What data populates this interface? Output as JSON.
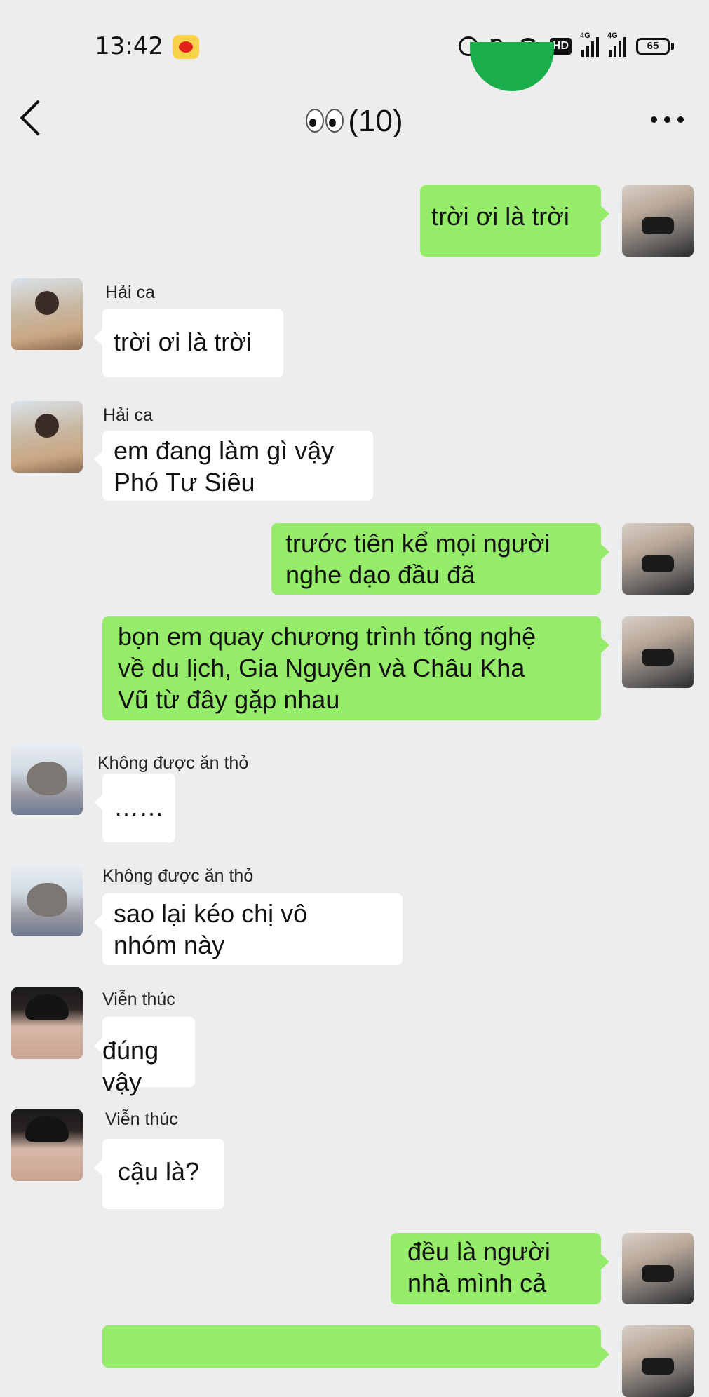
{
  "status_bar": {
    "time": "13:42",
    "hd_label": "HD",
    "network_1": "4G",
    "network_2": "4G",
    "battery": "65"
  },
  "chat": {
    "title": "(10)"
  },
  "messages": [
    {
      "side": "right",
      "sender": "",
      "text": "trời ơi là trời"
    },
    {
      "side": "left",
      "sender": "Hải ca",
      "text": "trời ơi là trời"
    },
    {
      "side": "left",
      "sender": "Hải ca",
      "text": "em đang làm gì vậy\nPhó Tư Siêu"
    },
    {
      "side": "right",
      "sender": "",
      "text": "trước tiên kể mọi người\nnghe dạo đầu đã"
    },
    {
      "side": "right",
      "sender": "",
      "text": "bọn em quay chương trình tống nghệ\nvề du lịch, Gia Nguyên và Châu Kha\nVũ từ đây gặp nhau"
    },
    {
      "side": "left",
      "sender": "Không được ăn thỏ",
      "text": "……"
    },
    {
      "side": "left",
      "sender": "Không được ăn thỏ",
      "text": "sao lại kéo chị vô\nnhóm này"
    },
    {
      "side": "left",
      "sender": "Viễn thúc",
      "text": "đúng vậy"
    },
    {
      "side": "left",
      "sender": "Viễn thúc",
      "text": "cậu là?"
    },
    {
      "side": "right",
      "sender": "",
      "text": "đều là người\nnhà mình cả"
    }
  ]
}
